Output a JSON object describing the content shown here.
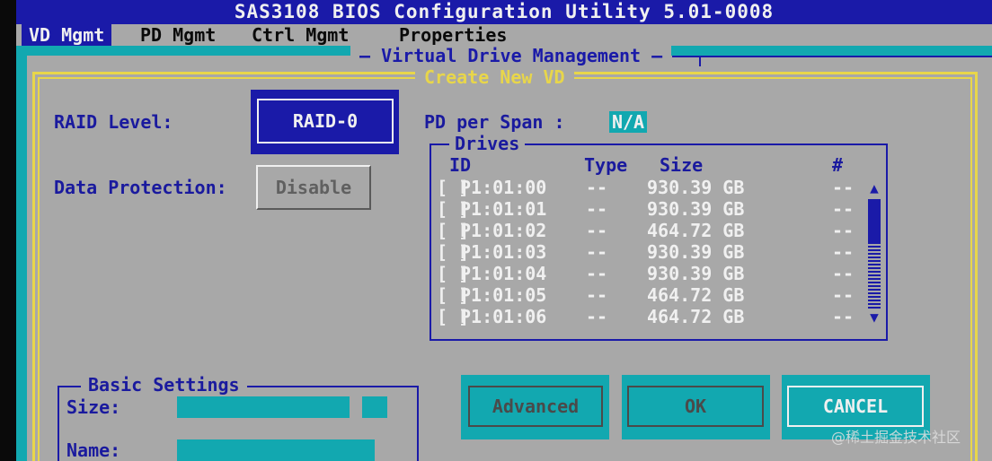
{
  "window": {
    "title": "SAS3108 BIOS Configuration Utility 5.01-0008"
  },
  "menu": {
    "items": [
      {
        "label": "VD Mgmt",
        "active": true
      },
      {
        "label": "PD Mgmt",
        "active": false
      },
      {
        "label": "Ctrl Mgmt",
        "active": false
      },
      {
        "label": "Properties",
        "active": false
      }
    ]
  },
  "panel": {
    "title": "Virtual Drive Management"
  },
  "dialog": {
    "title": "Create New VD",
    "raid_label": "RAID Level:",
    "raid_value": "RAID-0",
    "data_protection_label": "Data Protection:",
    "data_protection_value": "Disable",
    "pd_per_span_label": "PD per Span :",
    "pd_per_span_value": "N/A"
  },
  "drives": {
    "title": "Drives",
    "headers": {
      "id": "ID",
      "type": "Type",
      "size": "Size",
      "num": "#"
    },
    "rows": [
      {
        "check": "[ ]",
        "id": "P1:01:00",
        "type": "--",
        "size": "930.39 GB",
        "num": "--"
      },
      {
        "check": "[ ]",
        "id": "P1:01:01",
        "type": "--",
        "size": "930.39 GB",
        "num": "--"
      },
      {
        "check": "[ ]",
        "id": "P1:01:02",
        "type": "--",
        "size": "464.72 GB",
        "num": "--"
      },
      {
        "check": "[ ]",
        "id": "P1:01:03",
        "type": "--",
        "size": "930.39 GB",
        "num": "--"
      },
      {
        "check": "[ ]",
        "id": "P1:01:04",
        "type": "--",
        "size": "930.39 GB",
        "num": "--"
      },
      {
        "check": "[ ]",
        "id": "P1:01:05",
        "type": "--",
        "size": "464.72 GB",
        "num": "--"
      },
      {
        "check": "[ ]",
        "id": "P1:01:06",
        "type": "--",
        "size": "464.72 GB",
        "num": "--"
      }
    ],
    "scroll_up_icon": "triangle-up-icon",
    "scroll_down_icon": "triangle-down-icon"
  },
  "basic_settings": {
    "title": "Basic Settings",
    "size_label": "Size:",
    "name_label": "Name:"
  },
  "buttons": {
    "advanced": "Advanced",
    "ok": "OK",
    "cancel": "CANCEL"
  },
  "watermark": "@稀土掘金技术社区",
  "colors": {
    "bios_blue": "#1a1aa8",
    "bios_gray": "#a8a8a8",
    "bios_cyan": "#12a8b0",
    "bios_yellow": "#e8d64a",
    "bios_white": "#f0f0f0"
  }
}
